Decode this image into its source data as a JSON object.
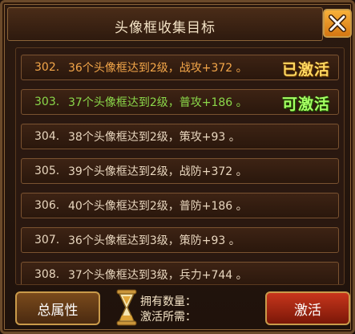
{
  "title": "头像框收集目标",
  "items": [
    {
      "num": "302.",
      "text": "36个头像框达到2级，战攻+372 。",
      "status": "已激活"
    },
    {
      "num": "303.",
      "text": "37个头像框达到2级，普攻+186 。",
      "status": "可激活"
    },
    {
      "num": "304.",
      "text": "38个头像框达到2级，策攻+93 。",
      "status": ""
    },
    {
      "num": "305.",
      "text": "39个头像框达到2级，战防+372 。",
      "status": ""
    },
    {
      "num": "306.",
      "text": "40个头像框达到2级，普防+186 。",
      "status": ""
    },
    {
      "num": "307.",
      "text": "36个头像框达到3级，策防+93 。",
      "status": ""
    },
    {
      "num": "308.",
      "text": "37个头像框达到3级，兵力+744 。",
      "status": ""
    }
  ],
  "footer": {
    "total_attr_button": "总属性",
    "owned_label": "拥有数量：",
    "required_label": "激活所需：",
    "activate_button": "激活"
  },
  "colors": {
    "activated_text": "#f3a649",
    "activatable_text": "#8bd84a",
    "normal_text": "#e9d7bf"
  }
}
